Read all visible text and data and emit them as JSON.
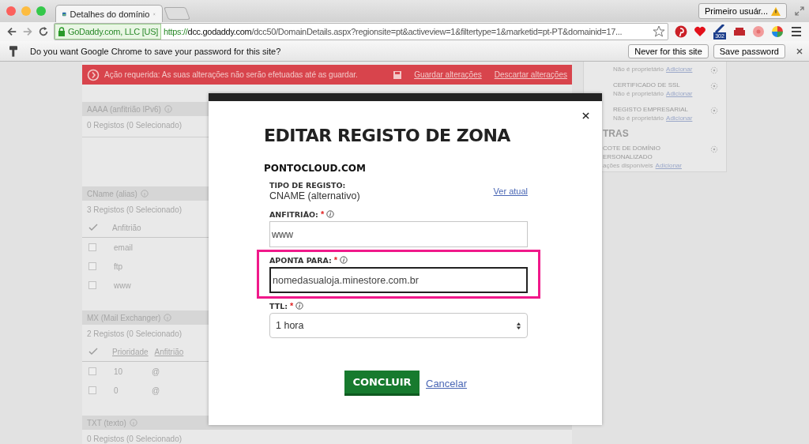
{
  "browser": {
    "tab": {
      "title": "Detalhes do domínio",
      "selected": true
    },
    "profile": "Primeiro usuár...",
    "ev_badge": "GoDaddy.com, LLC [US]",
    "url": {
      "scheme": "https://",
      "host": "dcc.godaddy.com",
      "path": "/dcc50/DomainDetails.aspx?regionsite=pt&activeview=1&filtertype=1&marketid=pt-PT&domainid=17..."
    },
    "extension_badge": "302"
  },
  "password_bar": {
    "message": "Do you want Google Chrome to save your password for this site?",
    "buttons": [
      "Never for this site",
      "Save password"
    ]
  },
  "alert_banner": {
    "message": "Ação requerida: As suas alterações não serão efetuadas até as guardar.",
    "actions": [
      "Guardar alterações",
      "Descartar alterações"
    ]
  },
  "record_sections": [
    {
      "title": "AAAA (anfitrião IPv6)",
      "summary": "0 Registos (0 Selecionado)"
    },
    {
      "title": "CName (alias)",
      "summary": "3 Registos (0 Selecionado)",
      "columns": [
        "Anfitrião"
      ],
      "rows": [
        {
          "checked": false,
          "cells": [
            "email"
          ]
        },
        {
          "checked": false,
          "cells": [
            "ftp"
          ]
        },
        {
          "checked": false,
          "cells": [
            "www"
          ]
        }
      ]
    },
    {
      "title": "MX (Mail Exchanger)",
      "summary": "2 Registos (0 Selecionado)",
      "columns": [
        "Prioridade",
        "Anfitrião"
      ],
      "rows": [
        {
          "checked": false,
          "cells": [
            "10",
            "@"
          ]
        },
        {
          "checked": false,
          "cells": [
            "0",
            "@"
          ]
        }
      ]
    },
    {
      "title": "TXT (texto)",
      "summary": "0 Registos (0 Selecionado)"
    }
  ],
  "sidebar": {
    "items": [
      {
        "status": "Não é proprietário",
        "link": "Adicionar"
      },
      {
        "title": "CERTIFICADO DE SSL",
        "status": "Não é proprietário",
        "link": "Adicionar"
      },
      {
        "title": "REGISTO EMPRESARIAL",
        "status": "Não é proprietário",
        "link": "Adicionar"
      }
    ],
    "extras_heading": "TRAS",
    "extras": [
      {
        "title_lines": [
          "COTE DE DOMÍNIO",
          "ERSONALIZADO"
        ],
        "status": "ações disponíveis",
        "link": "Adicionar"
      }
    ]
  },
  "modal": {
    "title": "EDITAR REGISTO DE ZONA",
    "domain": "PONTOCLOUD.COM",
    "record_type_label": "TIPO DE REGISTO:",
    "record_type": "CNAME (alternativo)",
    "view_link": "Ver atual",
    "fields": [
      {
        "kind": "text",
        "label": "ANFITRIÃO:",
        "required": true,
        "value": "www",
        "highlighted": false,
        "focused": false
      },
      {
        "kind": "text",
        "label": "APONTA PARA:",
        "required": true,
        "value": "nomedasualoja.minestore.com.br",
        "highlighted": true,
        "focused": true
      },
      {
        "kind": "select",
        "label": "TTL:",
        "required": true,
        "value": "1 hora",
        "highlighted": false,
        "focused": false
      }
    ],
    "required_mark": "*",
    "submit": "CONCLUIR",
    "cancel": "Cancelar"
  }
}
